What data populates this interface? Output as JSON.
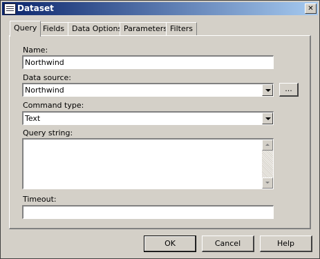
{
  "window": {
    "title": "Dataset",
    "close_glyph": "✕"
  },
  "tabs": [
    {
      "label": "Query",
      "active": true
    },
    {
      "label": "Fields"
    },
    {
      "label": "Data Options"
    },
    {
      "label": "Parameters"
    },
    {
      "label": "Filters"
    }
  ],
  "form": {
    "name_label": "Name:",
    "name_value": "Northwind",
    "data_source_label": "Data source:",
    "data_source_value": "Northwind",
    "browse_label": "...",
    "command_type_label": "Command type:",
    "command_type_value": "Text",
    "query_string_label": "Query string:",
    "query_string_value": "",
    "timeout_label": "Timeout:",
    "timeout_value": ""
  },
  "buttons": {
    "ok": "OK",
    "cancel": "Cancel",
    "help": "Help"
  },
  "icons": {
    "title": "dataset-table-icon",
    "dropdown": "chevron-down-icon"
  }
}
